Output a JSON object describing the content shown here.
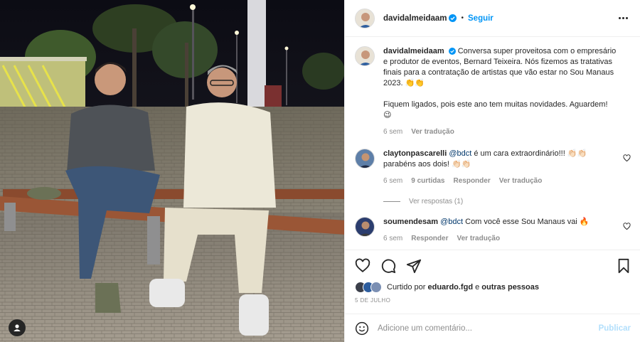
{
  "post": {
    "author": "davidalmeidaam",
    "follow_label": "Seguir",
    "dot": "•",
    "more_icon": "more-horizontal-icon"
  },
  "caption": {
    "username": "davidalmeidaam",
    "text1": "Conversa super proveitosa com o empresário e produtor de eventos, Bernard Teixeira. Nós fizemos as tratativas finais para a contratação de artistas que vão estar no Sou Manaus 2023. 👏👏",
    "text2": "Fiquem ligados, pois este ano tem muitas novidades. Aguardem! 😉",
    "time": "6 sem",
    "translate": "Ver tradução"
  },
  "comments": [
    {
      "username": "claytonpascarelli",
      "mention": "@bdct",
      "text": " é um cara extraordinário!!! 👏🏻👏🏻 parabéns aos dois! 👏🏻👏🏻",
      "time": "6 sem",
      "likes": "9 curtidas",
      "reply": "Responder",
      "translate": "Ver tradução",
      "view_replies": "Ver respostas (1)"
    },
    {
      "username": "soumendesam",
      "mention": "@bdct",
      "text": " Com você esse Sou Manaus vai 🔥",
      "time": "6 sem",
      "reply": "Responder",
      "translate": "Ver tradução"
    }
  ],
  "likes": {
    "prefix": "Curtido por",
    "user": "eduardo.fgd",
    "joiner": "e",
    "others": "outras pessoas"
  },
  "date": "5 DE JULHO",
  "composer": {
    "placeholder": "Adicione um comentário...",
    "publish": "Publicar"
  },
  "colors": {
    "link": "#0095f6",
    "verified": "#0095f6",
    "muted": "#8e8e8e",
    "publish_disabled": "#b2dffc"
  }
}
